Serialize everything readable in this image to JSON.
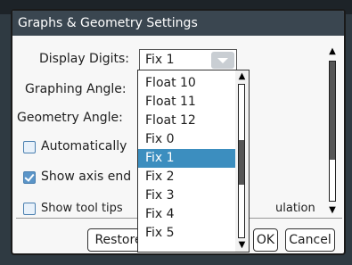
{
  "dialog": {
    "title": "Graphs & Geometry Settings",
    "display_digits_label": "Display Digits:",
    "display_digits_value": "Fix 1",
    "graphing_angle_label": "Graphing Angle:",
    "geometry_angle_label": "Geometry Angle:",
    "auto_label": "Automatically",
    "show_axis_label": "Show axis end",
    "show_tool_tips_label": "Show tool tips",
    "tool_tips_suffix": "ulation",
    "restore_label": "Restore",
    "ok_label": "OK",
    "cancel_label": "Cancel"
  },
  "dropdown": {
    "items": [
      "Float 10",
      "Float 11",
      "Float 12",
      "Fix 0",
      "Fix 1",
      "Fix 2",
      "Fix 3",
      "Fix 4",
      "Fix 5"
    ],
    "selected": "Fix 1"
  },
  "colors": {
    "title_bar": "#3a4650",
    "selection": "#3c8ebf",
    "checkbox": "#5b95c8"
  },
  "icons": [
    "chevron-down-icon",
    "scroll-up-icon",
    "scroll-down-icon",
    "checkmark-icon"
  ]
}
